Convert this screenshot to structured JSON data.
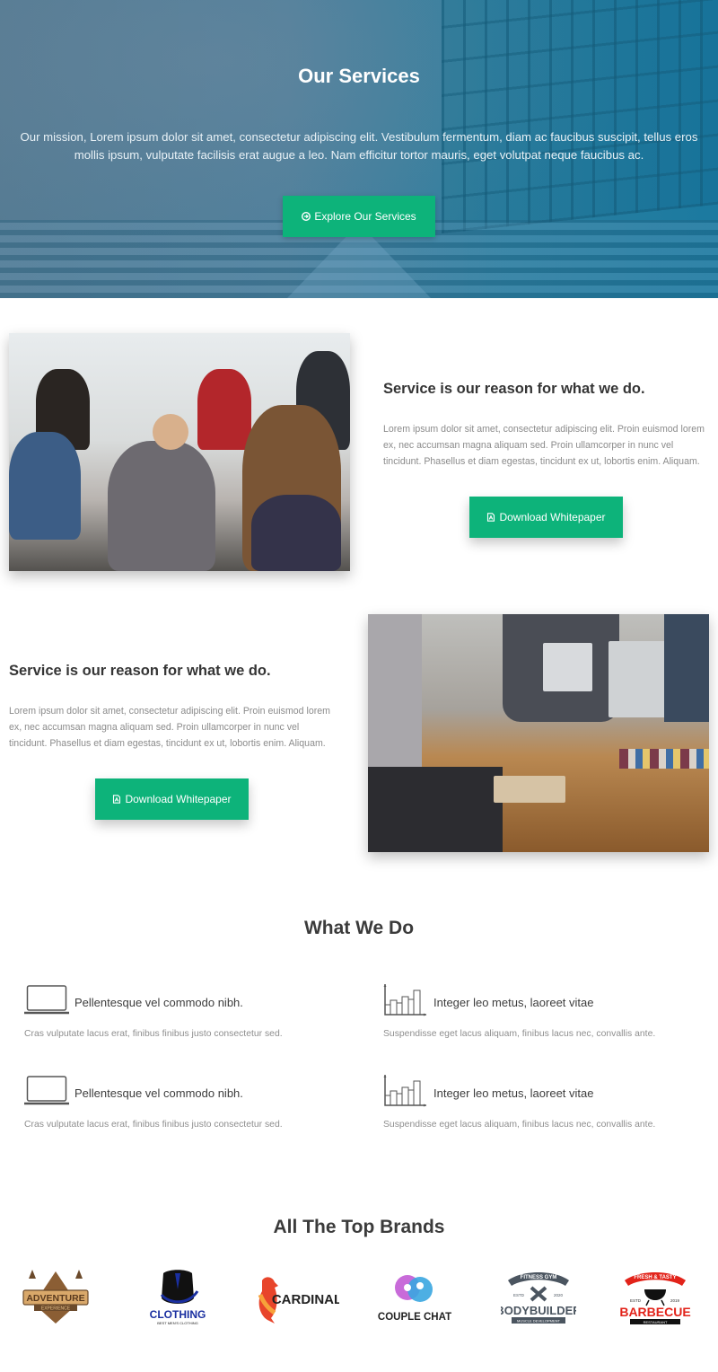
{
  "hero": {
    "title": "Our Services",
    "text": "Our mission, Lorem ipsum dolor sit amet, consectetur adipiscing elit. Vestibulum fermentum, diam ac faucibus suscipit, tellus eros mollis ipsum, vulputate facilisis erat augue a leo. Nam efficitur tortor mauris, eget volutpat neque faucibus ac.",
    "button_label": "Explore Our Services",
    "button_icon": "arrow-circle-right-icon"
  },
  "features": [
    {
      "title": "Service is our reason for what we do.",
      "text": "Lorem ipsum dolor sit amet, consectetur adipiscing elit. Proin euismod lorem ex, nec accumsan magna aliquam sed. Proin ullamcorper in nunc vel tincidunt. Phasellus et diam egestas, tincidunt ex ut, lobortis enim. Aliquam.",
      "button_label": "Download Whitepaper",
      "button_icon": "file-pdf-icon",
      "image": "team-meeting-photo"
    },
    {
      "title": "Service is our reason for what we do.",
      "text": "Lorem ipsum dolor sit amet, consectetur adipiscing elit. Proin euismod lorem ex, nec accumsan magna aliquam sed. Proin ullamcorper in nunc vel tincidunt. Phasellus et diam egestas, tincidunt ex ut, lobortis enim. Aliquam.",
      "button_label": "Download Whitepaper",
      "button_icon": "file-pdf-icon",
      "image": "laptops-meeting-photo"
    }
  ],
  "what_we_do": {
    "title": "What We Do",
    "items": [
      {
        "icon": "laptop-icon",
        "title": "Pellentesque vel commodo nibh.",
        "text": "Cras vulputate lacus erat, finibus finibus justo consectetur sed."
      },
      {
        "icon": "bar-chart-icon",
        "title": "Integer leo metus, laoreet vitae",
        "text": "Suspendisse eget lacus aliquam, finibus lacus nec, convallis ante."
      },
      {
        "icon": "laptop-icon",
        "title": "Pellentesque vel commodo nibh.",
        "text": "Cras vulputate lacus erat, finibus finibus justo consectetur sed."
      },
      {
        "icon": "bar-chart-icon",
        "title": "Integer leo metus, laoreet vitae",
        "text": "Suspendisse eget lacus aliquam, finibus lacus nec, convallis ante."
      }
    ]
  },
  "brands": {
    "title": "All The Top Brands",
    "logos": [
      {
        "name": "ADVENTURE",
        "sub": "EXPERIENCE"
      },
      {
        "name": "CLOTHING",
        "sub": "BEST MEN'S CLOTHING"
      },
      {
        "name": "CARDINAL",
        "sub": ""
      },
      {
        "name": "COUPLE CHAT",
        "sub": ""
      },
      {
        "name": "BODYBUILDER",
        "top": "FITNESS GYM",
        "estd": "ESTD",
        "year": "2020",
        "sub": "MUSCLE DEVELOPMENT"
      },
      {
        "name": "BARBECUE",
        "top": "FRESH & TASTY",
        "estd": "ESTD",
        "year": "2019",
        "sub": "RESTAURANT"
      }
    ]
  },
  "colors": {
    "accent_green": "#0db37a",
    "heading": "#353535",
    "body_text": "#8b8b8b",
    "hero_overlay": "#2c7fa0"
  }
}
